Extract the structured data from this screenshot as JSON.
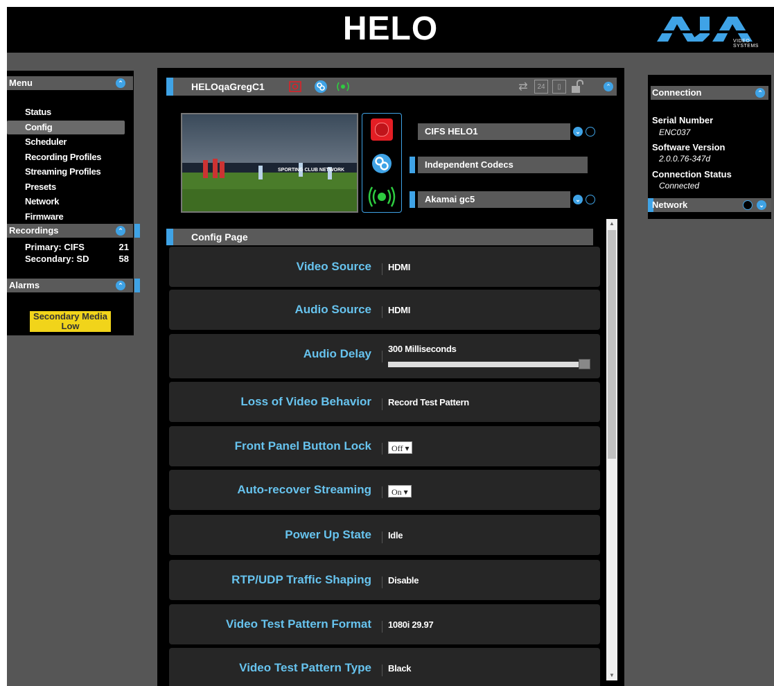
{
  "header": {
    "title": "HELO",
    "logo_text": "AJA",
    "logo_sub": "VIDEO SYSTEMS"
  },
  "menu": {
    "title": "Menu",
    "items": [
      {
        "label": "Status"
      },
      {
        "label": "Config",
        "selected": true
      },
      {
        "label": "Scheduler"
      },
      {
        "label": "Recording Profiles"
      },
      {
        "label": "Streaming Profiles"
      },
      {
        "label": "Presets"
      },
      {
        "label": "Network"
      },
      {
        "label": "Firmware"
      }
    ]
  },
  "recordings": {
    "title": "Recordings",
    "rows": [
      {
        "label": "Primary: CIFS",
        "count": "21"
      },
      {
        "label": "Secondary: SD",
        "count": "58"
      }
    ]
  },
  "alarms": {
    "title": "Alarms",
    "badge_line1": "Secondary Media",
    "badge_line2": "Low",
    "badge_color": "#f1d41a"
  },
  "device": {
    "name": "HELOqaGregC1",
    "record_destination": "CIFS HELO1",
    "codec_mode": "Independent Codecs",
    "stream_destination": "Akamai gc5",
    "thumbnail_caption": "SPORTING CLUB NETWORK"
  },
  "config": {
    "title": "Config Page",
    "rows": [
      {
        "label": "Video Source",
        "value": "HDMI"
      },
      {
        "label": "Audio Source",
        "value": "HDMI"
      },
      {
        "label": "Audio Delay",
        "value": "300 Milliseconds",
        "slider_fraction": 1.0
      },
      {
        "label": "Loss of Video Behavior",
        "value": "Record Test Pattern"
      },
      {
        "label": "Front Panel Button Lock",
        "value": "Off"
      },
      {
        "label": "Auto-recover Streaming",
        "value": "On"
      },
      {
        "label": "Power Up State",
        "value": "Idle"
      },
      {
        "label": "RTP/UDP Traffic Shaping",
        "value": "Disable"
      },
      {
        "label": "Video Test Pattern Format",
        "value": "1080i 29.97"
      },
      {
        "label": "Video Test Pattern Type",
        "value": "Black"
      }
    ]
  },
  "connection": {
    "title": "Connection",
    "serial_label": "Serial Number",
    "serial_value": "ENC037",
    "software_label": "Software Version",
    "software_value": "2.0.0.76-347d",
    "status_label": "Connection Status",
    "status_value": "Connected"
  },
  "network": {
    "title": "Network"
  },
  "colors": {
    "accent": "#3fa3e6",
    "label_blue": "#67c3ee",
    "record_red": "#e31e24",
    "stream_green": "#2ecc40"
  }
}
